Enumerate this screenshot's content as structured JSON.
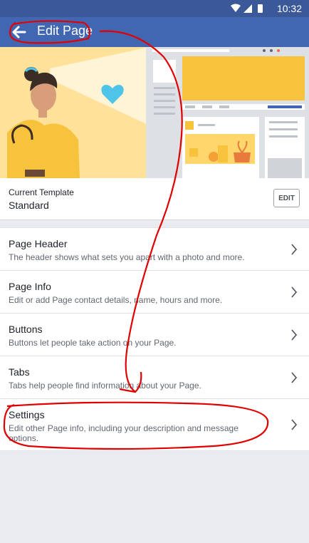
{
  "status": {
    "time": "10:32"
  },
  "header": {
    "title": "Edit Page"
  },
  "template": {
    "label": "Current Template",
    "value": "Standard",
    "edit_label": "EDIT"
  },
  "menu": [
    {
      "title": "Page Header",
      "desc": "The header shows what sets you apart with a photo and more."
    },
    {
      "title": "Page Info",
      "desc": "Edit or add Page contact details, name, hours and more."
    },
    {
      "title": "Buttons",
      "desc": "Buttons let people take action on your Page."
    },
    {
      "title": "Tabs",
      "desc": "Tabs help people find information about your Page."
    },
    {
      "title": "Settings",
      "desc": "Edit other Page info, including your description and message options."
    }
  ],
  "colors": {
    "brand": "#4267b2",
    "statusbar": "#3b5998",
    "annotation": "#e00000"
  },
  "icons": {
    "back": "arrow-left-icon",
    "chevron": "chevron-right-icon"
  }
}
